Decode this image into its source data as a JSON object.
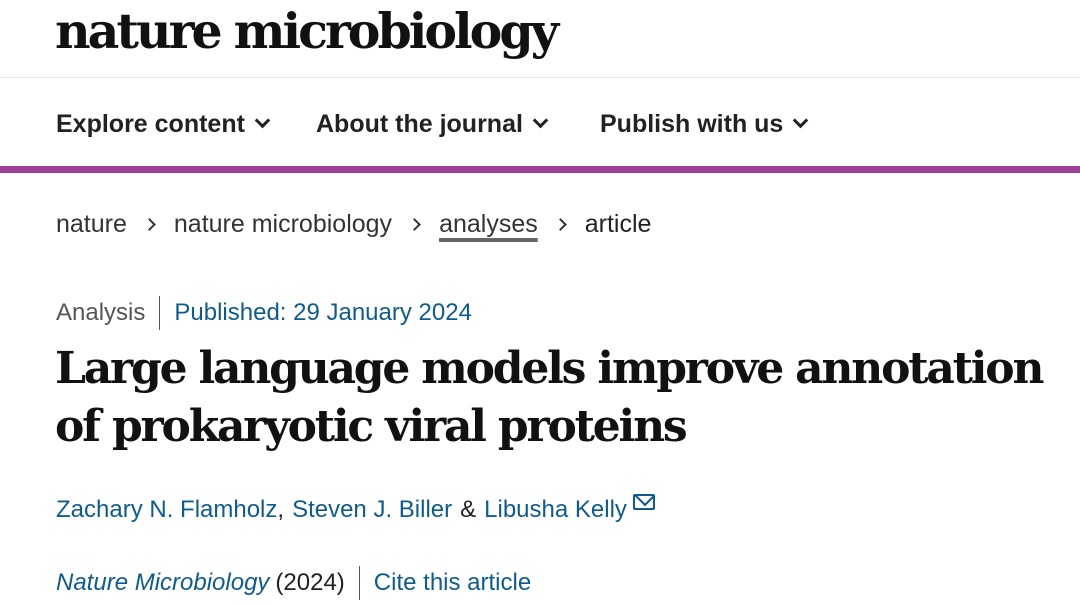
{
  "masthead": {
    "logo_text": "nature microbiology"
  },
  "nav": {
    "items": [
      {
        "label": "Explore content"
      },
      {
        "label": "About the journal"
      },
      {
        "label": "Publish with us"
      }
    ],
    "accent_color": "#9b3f99"
  },
  "breadcrumb": {
    "items": [
      "nature",
      "nature microbiology",
      "analyses",
      "article"
    ]
  },
  "article": {
    "type": "Analysis",
    "published": "Published: 29 January 2024",
    "title": "Large language models improve annotation of prokaryotic viral proteins",
    "authors": [
      {
        "name": "Zachary N. Flamholz"
      },
      {
        "name": "Steven J. Biller"
      },
      {
        "name": "Libusha Kelly"
      }
    ],
    "author_separator_1": ",",
    "author_separator_2": "&",
    "journal": "Nature Microbiology",
    "year": "(2024)",
    "cite_label": "Cite this article"
  },
  "colors": {
    "link": "#0f5c8c",
    "text": "#222222"
  }
}
